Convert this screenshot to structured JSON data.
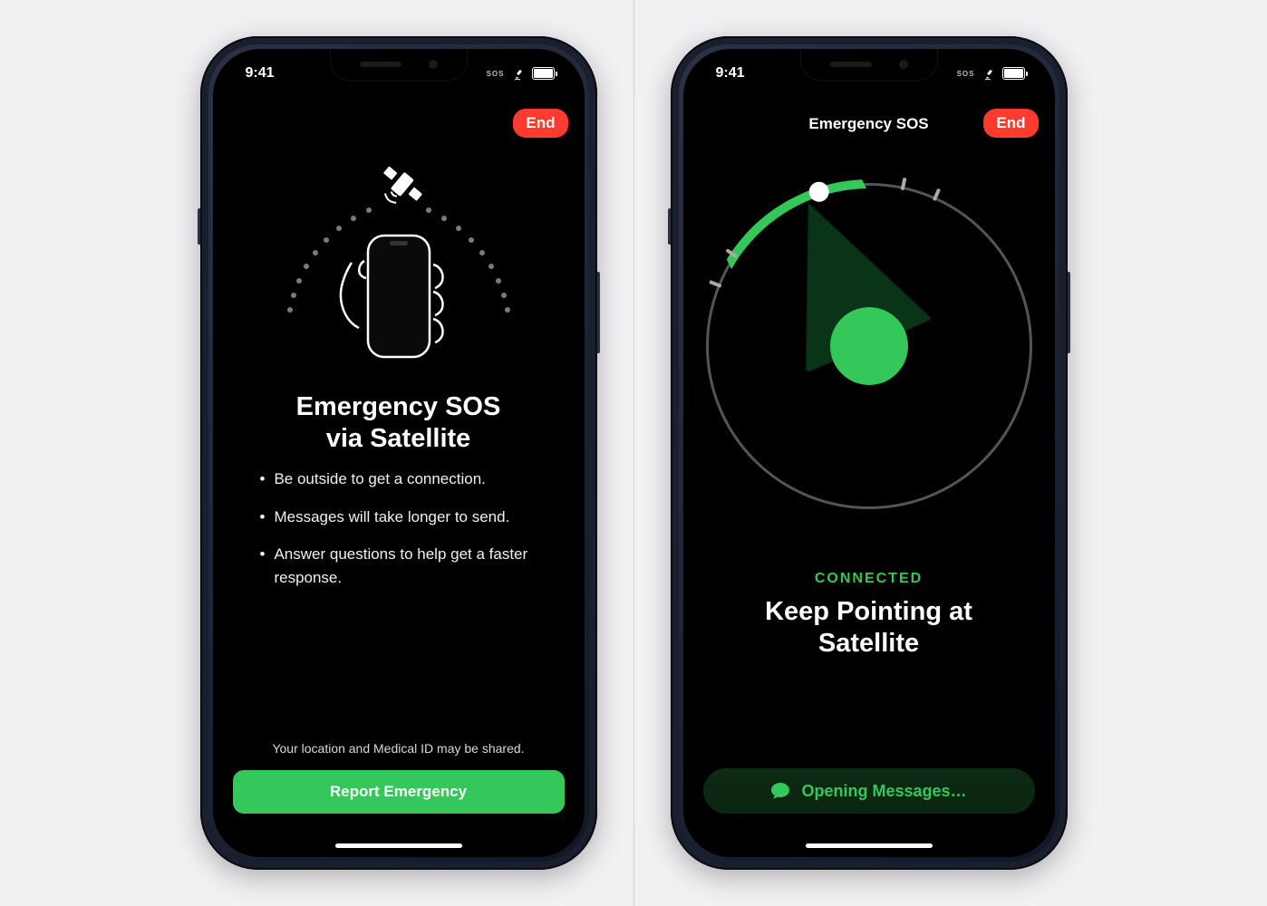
{
  "status_bar": {
    "time": "9:41",
    "sos_label": "SOS"
  },
  "screen1": {
    "nav": {
      "end_label": "End"
    },
    "title": "Emergency SOS\nvia Satellite",
    "bullets": [
      "Be outside to get a connection.",
      "Messages will take longer to send.",
      "Answer questions to help get a faster response."
    ],
    "footnote": "Your location and Medical ID may be shared.",
    "cta_label": "Report Emergency"
  },
  "screen2": {
    "nav": {
      "title": "Emergency SOS",
      "end_label": "End"
    },
    "status_label": "CONNECTED",
    "instruction": "Keep Pointing at Satellite",
    "pill_label": "Opening Messages…"
  }
}
